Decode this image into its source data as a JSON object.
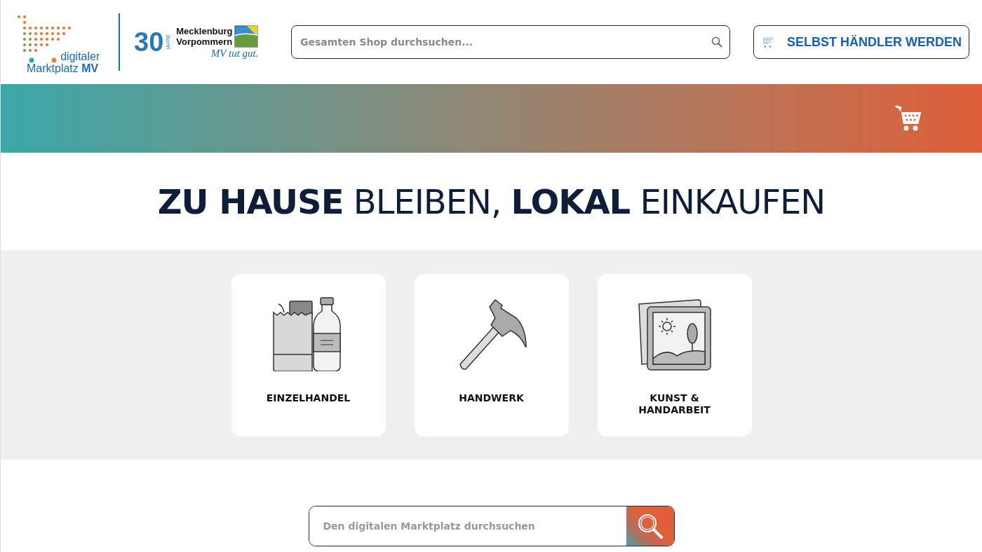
{
  "logo": {
    "line_1": "digitaler",
    "line_2": "Marktplatz **MV**"
  },
  "partner_logo": {
    "number": "30",
    "unit": "JAHRE",
    "name_1": "Mecklenburg",
    "name_2": "Vorpommern",
    "slogan": "MV tut gut."
  },
  "header_search": {
    "placeholder": "Gesamten Shop durchsuchen..."
  },
  "merchant_button": {
    "label": "SELBST HÄNDLER WERDEN"
  },
  "headline": "**ZU HAUSE** BLEIBEN, **LOKAL** EINKAUFEN",
  "categories": [
    {
      "kind": "retail",
      "label": "EINZELHANDEL"
    },
    {
      "kind": "craft",
      "label": "HANDWERK"
    },
    {
      "kind": "art",
      "label": "KUNST & HANDARBEIT"
    }
  ],
  "marketplace_search": {
    "placeholder": "Den digitalen Marktplatz durchsuchen"
  }
}
